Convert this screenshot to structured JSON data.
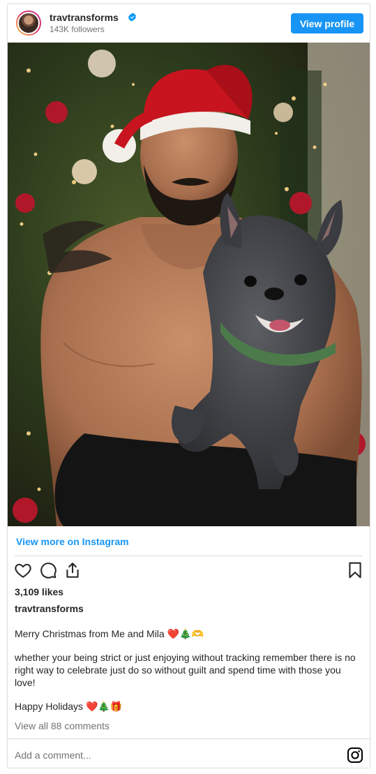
{
  "header": {
    "username": "travtransforms",
    "followers": "143K followers",
    "view_profile_label": "View profile"
  },
  "view_more_label": "View more on Instagram",
  "post": {
    "likes": "3,109 likes",
    "caption_username": "travtransforms",
    "caption_lines": [
      "Merry Christmas from Me and Mila ❤️🎄🫶",
      "whether your being strict or just enjoying without tracking remember there is no right way to celebrate just do so without guilt and spend time with those you love!",
      "Happy Holidays ❤️🎄🎁"
    ],
    "view_comments": "View all 88 comments"
  },
  "comment_box": {
    "placeholder": "Add a comment..."
  },
  "icons": {
    "like": "heart-icon",
    "comment": "comment-icon",
    "share": "share-icon",
    "save": "bookmark-icon",
    "instagram": "instagram-logo-icon",
    "verified": "verified-badge-icon"
  },
  "colors": {
    "accent": "#1895f4",
    "text": "#262626",
    "muted": "#737373",
    "border": "#dbdbdb"
  }
}
